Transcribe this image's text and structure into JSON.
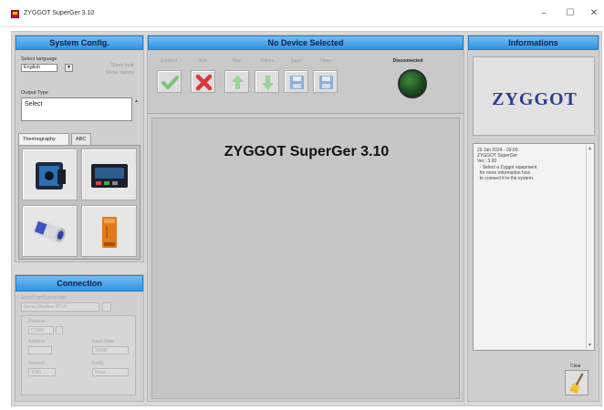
{
  "window": {
    "title": "ZYGGOT SuperGer 3.10",
    "minimize": "–",
    "maximize": "☐",
    "close": "✕"
  },
  "system_config": {
    "header": "System Config.",
    "language_label": "Select language",
    "language_value": "English",
    "option_1": "Show help",
    "option_2": "Show history",
    "output_label": "Output Type",
    "output_value": "Select",
    "tabs": [
      "Thermography",
      "ABC"
    ]
  },
  "connection": {
    "header": "Connection",
    "port_label": "Serial Port/Connection",
    "port_value": "Serial (Modbus RTU)",
    "protocol_label": "Protocol",
    "protocol_value": "COM1",
    "address_label": "Address",
    "baud_label": "Baud Rate",
    "baud_value": "19200",
    "timeout_label": "Timeout",
    "timeout_value": "1000",
    "parity_label": "Parity",
    "parity_value": "None"
  },
  "device": {
    "header": "No Device Selected",
    "toolbar": [
      "Connect",
      "Stop",
      "Next",
      "Return",
      "Save",
      "Open"
    ],
    "status_label": "Disconnected",
    "main_title": "ZYGGOT SuperGer 3.10"
  },
  "informations": {
    "header": "Informations",
    "logo": "ZYGGOT",
    "log": [
      "29 Jan 2024 - 09:00",
      "ZYGGOT SuperGer",
      "Ver.: 3.00",
      "",
      "  - Select a Zyggot equipment",
      "  for more information how",
      "  to connect it to the system."
    ],
    "clear_label": "Clear"
  },
  "colors": {
    "header_blue": "#2f92e0",
    "logo_blue": "#2f3e8e",
    "led_green": "#1c4d1c",
    "cancel_red": "#d93a3a",
    "check_green": "#7cc47c"
  },
  "icons": [
    "check-icon",
    "cancel-x-icon",
    "arrow-up-icon",
    "arrow-down-icon",
    "save-disk-icon",
    "open-disk-icon",
    "broom-icon",
    "app-icon"
  ]
}
